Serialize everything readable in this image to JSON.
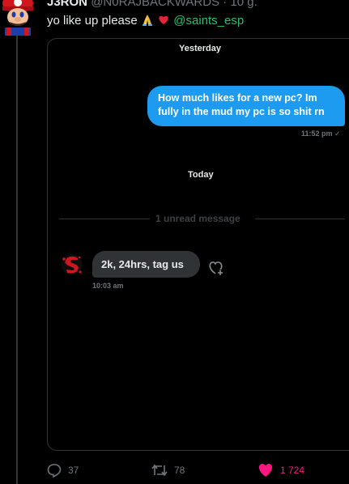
{
  "tweet": {
    "author_name": "J3RON",
    "author_handle": "@N0RAJBACKWARDS",
    "time_sep": " · ",
    "time": "10 g.",
    "text": "yo like up please",
    "emojis": [
      "folded-hands",
      "red-heart"
    ],
    "mention": "@saints_esp"
  },
  "dm": {
    "date_label_1": "Yesterday",
    "outgoing_message": "How much likes for a new pc? Im fully in the mud my pc is so shit rn",
    "outgoing_time": "11:52 pm",
    "date_label_2": "Today",
    "unread_divider": "1 unread message",
    "incoming_message": "2k, 24hrs, tag us",
    "incoming_time": "10:03 am"
  },
  "actions": {
    "reply_count": "37",
    "retweet_count": "78",
    "like_count": "1 724"
  },
  "colors": {
    "accent_blue": "#1d9bf0",
    "mention_green": "#25c16f",
    "like_pink": "#f91880",
    "muted": "#71767b"
  }
}
